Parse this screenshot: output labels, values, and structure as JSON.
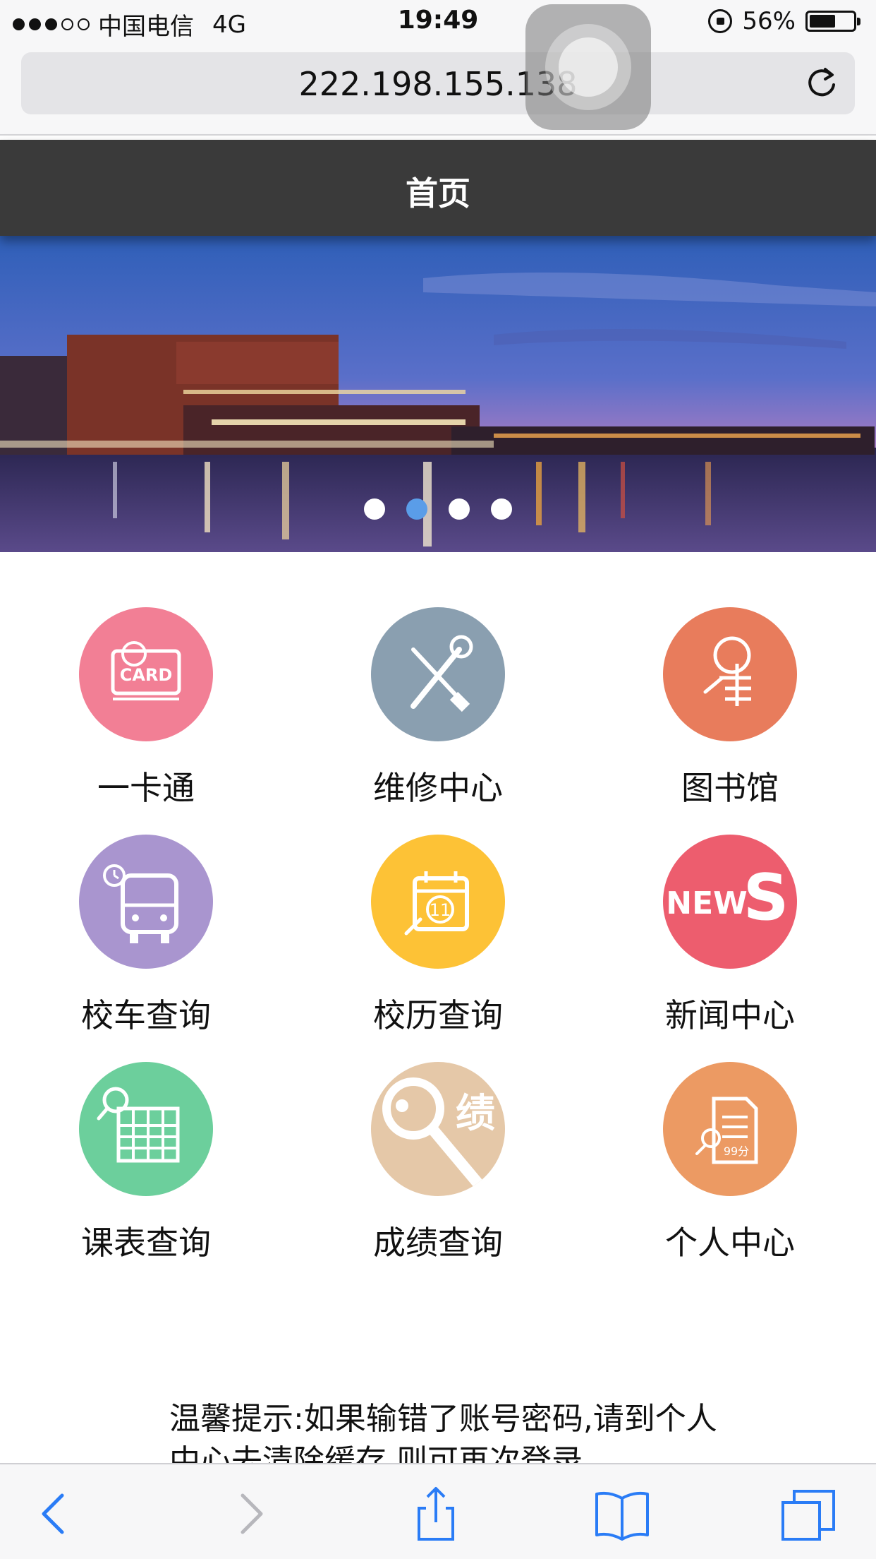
{
  "status": {
    "carrier": "中国电信",
    "network": "4G",
    "time": "19:49",
    "battery": "56%",
    "signal_bars": 3
  },
  "browser": {
    "url": "222.198.155.138"
  },
  "header": {
    "title": "首页"
  },
  "banner": {
    "slide_count": 4,
    "active_slide": 2
  },
  "menu": [
    {
      "label": "一卡通",
      "icon": "card-icon",
      "color": "#f27f95"
    },
    {
      "label": "维修中心",
      "icon": "wrench-screwdriver-icon",
      "color": "#8a9fb0"
    },
    {
      "label": "图书馆",
      "icon": "library-icon",
      "color": "#e87c5c"
    },
    {
      "label": "校车查询",
      "icon": "bus-icon",
      "color": "#a995cf"
    },
    {
      "label": "校历查询",
      "icon": "calendar-icon",
      "color": "#fdc236"
    },
    {
      "label": "新闻中心",
      "icon": "news-icon",
      "color": "#ed5d6e"
    },
    {
      "label": "课表查询",
      "icon": "timetable-icon",
      "color": "#6ccf9c"
    },
    {
      "label": "成绩查询",
      "icon": "grade-search-icon",
      "color": "#e5c8a8"
    },
    {
      "label": "个人中心",
      "icon": "personal-center-icon",
      "color": "#ec9a63"
    }
  ],
  "tip": {
    "text": "温馨提示:如果输错了账号密码,请到个人中心去清除缓存,则可再次登录"
  }
}
